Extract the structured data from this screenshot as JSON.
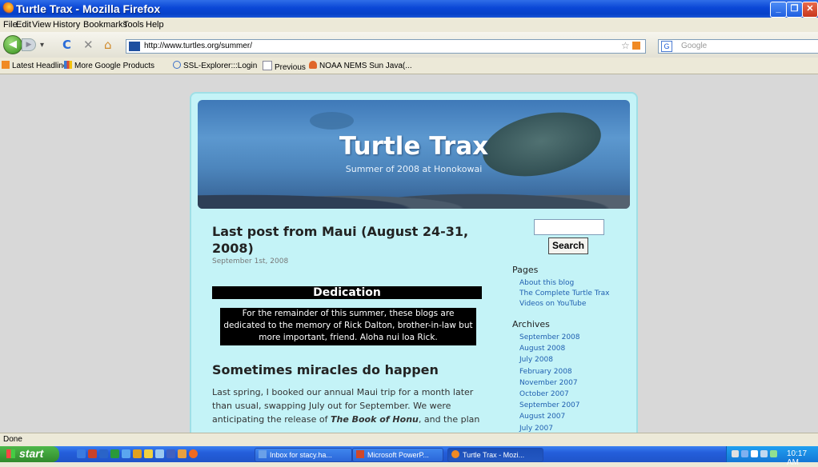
{
  "window": {
    "title": "Turtle Trax - Mozilla Firefox"
  },
  "menu": [
    "File",
    "Edit",
    "View",
    "History",
    "Bookmarks",
    "Tools",
    "Help"
  ],
  "nav": {
    "url": "http://www.turtles.org/summer/",
    "search_placeholder": "Google"
  },
  "bookmarks": [
    "Latest Headlines",
    "More Google Products",
    "SSL-Explorer:::Login",
    "Previous",
    "NOAA NEMS Sun Java(..."
  ],
  "site": {
    "title": "Turtle Trax",
    "subtitle": "Summer of 2008 at Honokowai"
  },
  "post": {
    "title": "Last post from Maui (August 24-31, 2008)",
    "date": "September 1st, 2008",
    "dedication_heading": "Dedication",
    "dedication_text": "For the remainder of this summer, these blogs are dedicated to the memory of Rick Dalton, brother-in-law but more important, friend. Aloha nui loa Rick.",
    "subheading": "Sometimes miracles do happen",
    "body_1": "Last spring, I booked our annual Maui trip for a month later than usual, swapping July out for September. We were anticipating the release of ",
    "body_book": "The Book of Honu",
    "body_2": ", and the plan"
  },
  "sidebar": {
    "search_label": "Search",
    "pages_heading": "Pages",
    "pages": [
      "About this blog",
      "The Complete Turtle Trax",
      "Videos on YouTube"
    ],
    "archives_heading": "Archives",
    "archives": [
      "September 2008",
      "August 2008",
      "July 2008",
      "February 2008",
      "November 2007",
      "October 2007",
      "September 2007",
      "August 2007",
      "July 2007"
    ]
  },
  "status": "Done",
  "taskbar": {
    "start_label": "start",
    "tasks": [
      "Inbox for stacy.ha...",
      "Microsoft PowerP...",
      "Turtle Trax - Mozi..."
    ],
    "clock": "10:17 AM"
  }
}
